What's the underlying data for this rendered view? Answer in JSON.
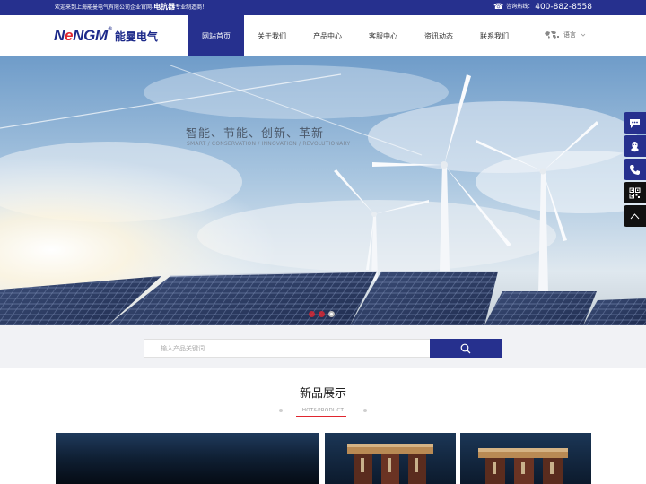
{
  "topbar": {
    "welcome_prefix": "欢迎来到上海能曼电气有限公司企业官网-",
    "welcome_highlight": "电抗器",
    "welcome_suffix": "专业制造商！",
    "hotline_label": "咨询热线：",
    "hotline_number": "400-882-8558"
  },
  "logo": {
    "word_prefix": "N",
    "word_e": "e",
    "word_suffix": "NGM",
    "reg": "®",
    "cn": "能曼电气"
  },
  "nav": {
    "items": [
      {
        "label": "网站首页",
        "active": true
      },
      {
        "label": "关于我们",
        "active": false
      },
      {
        "label": "产品中心",
        "active": false
      },
      {
        "label": "客服中心",
        "active": false
      },
      {
        "label": "资讯动态",
        "active": false
      },
      {
        "label": "联系我们",
        "active": false
      }
    ],
    "lang_label": "语言"
  },
  "banner": {
    "slogan": "智能、节能、创新、革新",
    "slogan_en": "SMART / CONSERVATION / INNOVATION / REVOLUTIONARY",
    "slides": 3,
    "active_slide": 3
  },
  "search": {
    "placeholder": "输入产品关键词"
  },
  "new_products": {
    "title": "新品展示",
    "subtitle": "HOT&PRODUCT"
  },
  "colors": {
    "brand": "#26308e",
    "accent": "#e0262f"
  },
  "side_tools": [
    "message-icon",
    "qq-icon",
    "phone-icon",
    "qrcode-icon",
    "back-to-top-icon"
  ]
}
